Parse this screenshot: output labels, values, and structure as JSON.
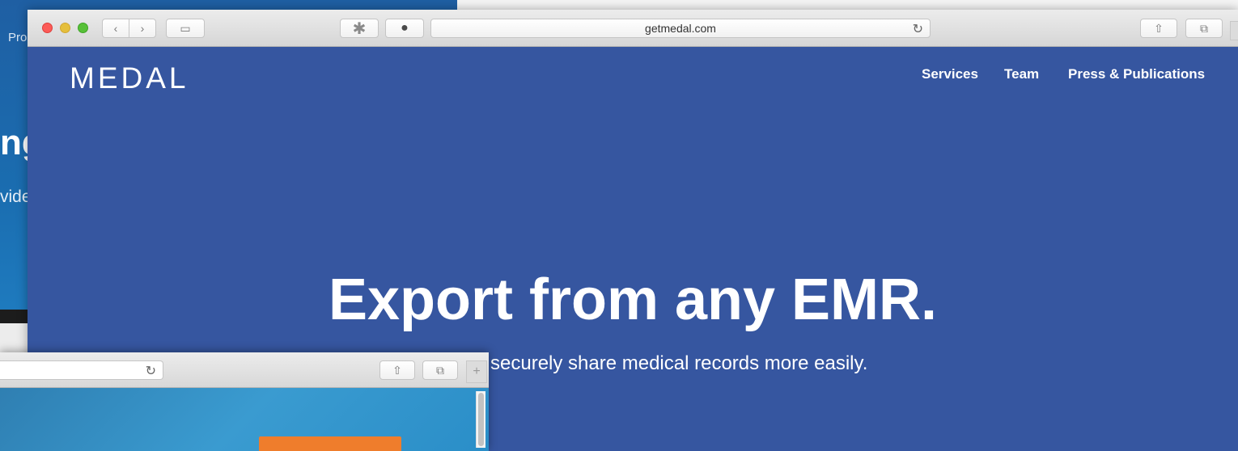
{
  "background_window": {
    "nav_fragment": "Pro",
    "heading_fragment": "ng",
    "sub_fragment": "vide"
  },
  "browser": {
    "url": "getmedal.com"
  },
  "page": {
    "logo": "MEDAL",
    "nav": [
      "Services",
      "Team",
      "Press & Publications"
    ],
    "hero_title": "Export from any EMR.",
    "hero_subtitle": "securely share medical records more easily."
  },
  "icons": {
    "back": "‹",
    "forward": "›",
    "sidebar": "▭",
    "ext1": "✱",
    "ext2": "●",
    "reload": "↻",
    "share": "⇧",
    "tabs": "⧉",
    "newtab": "+"
  }
}
